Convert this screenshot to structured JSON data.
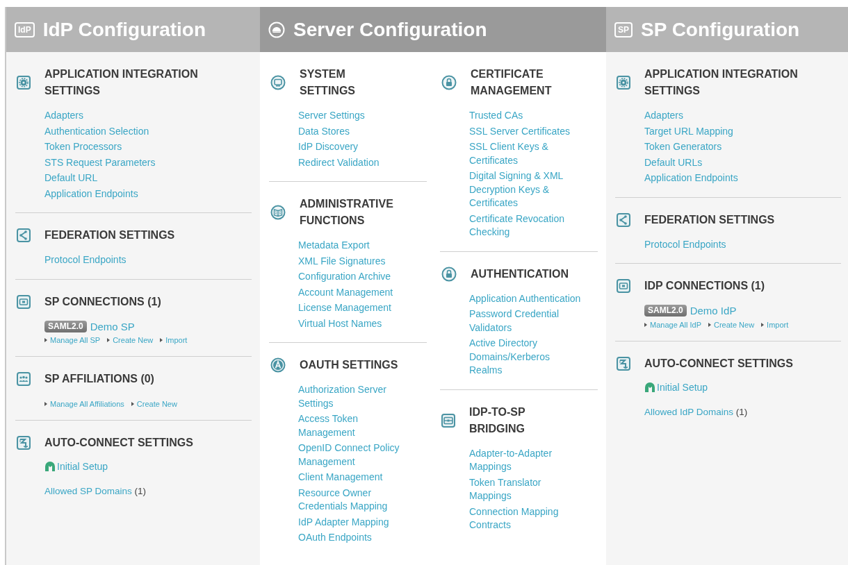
{
  "panels": [
    {
      "title": "IdP Configuration",
      "badge": "IdP",
      "selected": false,
      "columns": [
        [
          {
            "kind": "links",
            "title": "APPLICATION INTEGRATION\nSETTINGS",
            "links": [
              "Adapters",
              "Authentication Selection",
              "Token Processors",
              "STS Request Parameters",
              "Default URL",
              "Application Endpoints"
            ]
          },
          {
            "kind": "links",
            "title": "FEDERATION SETTINGS",
            "links": [
              "Protocol Endpoints"
            ]
          },
          {
            "kind": "connection",
            "title": "SP CONNECTIONS (1)",
            "protocol": "SAML2.0",
            "name": "Demo SP",
            "actions": [
              "Manage All SP",
              "Create New",
              "Import"
            ]
          },
          {
            "kind": "actions",
            "title": "SP AFFILIATIONS (0)",
            "actions": [
              "Manage All Affiliations",
              "Create New"
            ]
          },
          {
            "kind": "auto-connect",
            "title": "AUTO-CONNECT SETTINGS",
            "setup": "Initial Setup",
            "domains": "Allowed SP Domains",
            "count": "(1)"
          }
        ]
      ]
    },
    {
      "title": "Server Configuration",
      "selected": true,
      "columns": [
        [
          {
            "kind": "links",
            "title": "SYSTEM\nSETTINGS",
            "links": [
              "Server Settings",
              "Data Stores",
              "IdP Discovery",
              "Redirect Validation"
            ]
          },
          {
            "kind": "links",
            "title": "ADMINISTRATIVE\nFUNCTIONS",
            "links": [
              "Metadata Export",
              "XML File Signatures",
              "Configuration Archive",
              "Account Management",
              "License Management",
              "Virtual Host Names"
            ]
          },
          {
            "kind": "links",
            "title": "OAUTH SETTINGS",
            "links": [
              "Authorization Server\nSettings",
              "Access Token\nManagement",
              "OpenID Connect Policy\nManagement",
              "Client Management",
              "Resource Owner\nCredentials Mapping",
              "IdP Adapter Mapping",
              "OAuth Endpoints"
            ]
          }
        ],
        [
          {
            "kind": "links",
            "title": "CERTIFICATE\nMANAGEMENT",
            "links": [
              "Trusted CAs",
              "SSL Server Certificates",
              "SSL Client Keys &\nCertificates",
              "Digital Signing & XML\nDecryption Keys &\nCertificates",
              "Certificate Revocation\nChecking"
            ]
          },
          {
            "kind": "links",
            "title": "AUTHENTICATION",
            "links": [
              "Application Authentication",
              "Password Credential\nValidators",
              "Active Directory\nDomains/Kerberos\nRealms"
            ]
          },
          {
            "kind": "links",
            "title": "IDP-TO-SP\nBRIDGING",
            "links": [
              "Adapter-to-Adapter\nMappings",
              "Token Translator\nMappings",
              "Connection Mapping\nContracts"
            ]
          }
        ]
      ]
    },
    {
      "title": "SP Configuration",
      "badge": "SP",
      "selected": false,
      "columns": [
        [
          {
            "kind": "links",
            "title": "APPLICATION INTEGRATION\nSETTINGS",
            "links": [
              "Adapters",
              "Target URL Mapping",
              "Token Generators",
              "Default URLs",
              "Application Endpoints"
            ]
          },
          {
            "kind": "links",
            "title": "FEDERATION SETTINGS",
            "links": [
              "Protocol Endpoints"
            ]
          },
          {
            "kind": "connection",
            "title": "IDP CONNECTIONS (1)",
            "protocol": "SAML2.0",
            "name": "Demo IdP",
            "actions": [
              "Manage All IdP",
              "Create New",
              "Import"
            ]
          },
          {
            "kind": "auto-connect",
            "title": "AUTO-CONNECT SETTINGS",
            "setup": "Initial Setup",
            "domains": "Allowed IdP Domains",
            "count": "(1)"
          }
        ]
      ]
    }
  ]
}
